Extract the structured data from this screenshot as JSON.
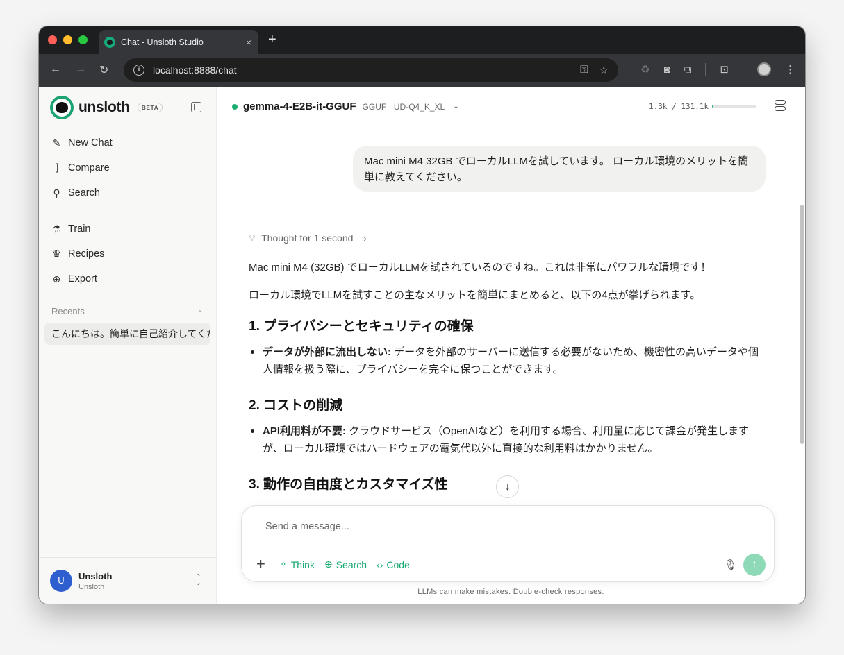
{
  "browser": {
    "tab_title": "Chat - Unsloth Studio",
    "tab_close": "×",
    "new_tab": "+",
    "url": "localhost:8888/chat"
  },
  "sidebar": {
    "brand": "unsloth",
    "badge": "BETA",
    "nav_primary": [
      {
        "label": "New Chat",
        "icon": "edit-icon"
      },
      {
        "label": "Compare",
        "icon": "compare-icon"
      },
      {
        "label": "Search",
        "icon": "search-icon"
      }
    ],
    "nav_secondary": [
      {
        "label": "Train",
        "icon": "flask-icon"
      },
      {
        "label": "Recipes",
        "icon": "chef-hat-icon"
      },
      {
        "label": "Export",
        "icon": "download-icon"
      }
    ],
    "recents_label": "Recents",
    "recents": [
      "こんにちは。簡単に自己紹介してください"
    ],
    "user": {
      "initial": "U",
      "name": "Unsloth",
      "sub": "Unsloth"
    }
  },
  "header": {
    "model_name": "gemma-4-E2B-it-GGUF",
    "model_meta": "GGUF · UD-Q4_K_XL",
    "context": "1.3k / 131.1k",
    "context_fraction": 0.01
  },
  "chat": {
    "user_message": "Mac mini M4 32GB でローカルLLMを試しています。 ローカル環境のメリットを簡単に教えてください。",
    "thought_label": "Thought for 1 second",
    "intro_1": "Mac mini M4 (32GB) でローカルLLMを試されているのですね。これは非常にパワフルな環境です！",
    "intro_2": "ローカル環境でLLMを試すことの主なメリットを簡単にまとめると、以下の4点が挙げられます。",
    "sections": [
      {
        "heading": "1. プライバシーとセキュリティの確保",
        "bullet_title": "データが外部に流出しない:",
        "bullet_text": " データを外部のサーバーに送信する必要がないため、機密性の高いデータや個人情報を扱う際に、プライバシーを完全に保つことができます。"
      },
      {
        "heading": "2. コストの削減",
        "bullet_title": "API利用料が不要:",
        "bullet_text": " クラウドサービス（OpenAIなど）を利用する場合、利用量に応じて課金が発生しますが、ローカル環境ではハードウェアの電気代以外に直接的な利用料はかかりません。"
      },
      {
        "heading": "3. 動作の自由度とカスタマイズ性"
      }
    ]
  },
  "composer": {
    "placeholder": "Send a message...",
    "tools": [
      {
        "label": "Think",
        "icon": "lightbulb-icon"
      },
      {
        "label": "Search",
        "icon": "globe-icon"
      },
      {
        "label": "Code",
        "icon": "code-icon"
      }
    ],
    "disclaimer": "LLMs can make mistakes. Double-check responses."
  },
  "colors": {
    "accent": "#16a970",
    "send_disabled": "#8ed9b6",
    "avatar": "#2f5fce"
  }
}
